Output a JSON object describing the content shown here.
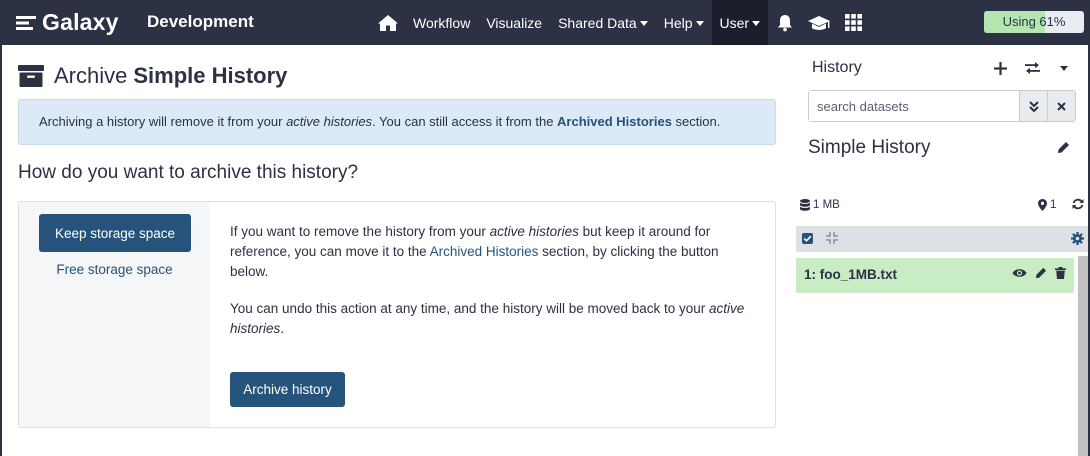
{
  "masthead": {
    "brand": "Galaxy",
    "subtitle": "Development",
    "nav": {
      "workflow": "Workflow",
      "visualize": "Visualize",
      "shared_data": "Shared Data",
      "help": "Help",
      "user": "User"
    },
    "icons": [
      "home-icon",
      "bell-icon",
      "graduation-cap-icon",
      "grid-apps-icon"
    ],
    "quota": {
      "label": "Using 61%",
      "percent": 61
    }
  },
  "main": {
    "title_prefix": "Archive",
    "title_name": "Simple History",
    "alert": {
      "part1": "Archiving a history will remove it from your ",
      "em": "active histories",
      "part2": ". You can still access it from the ",
      "strong": "Archived Histories",
      "part3": " section."
    },
    "question": "How do you want to archive this history?",
    "options": {
      "keep": "Keep storage space",
      "free": "Free storage space"
    },
    "body": {
      "p1_a": "If you want to remove the history from your ",
      "p1_em": "active histories",
      "p1_b": " but keep it around for reference, you can move it to the ",
      "p1_link": "Archived Histories",
      "p1_c": " section, by clicking the button below.",
      "p2_a": "You can undo this action at any time, and the history will be moved back to your ",
      "p2_em": "active histories",
      "p2_b": "."
    },
    "archive_button": "Archive history"
  },
  "history_panel": {
    "label": "History",
    "search_placeholder": "search datasets",
    "name": "Simple History",
    "size": "1 MB",
    "count": "1",
    "datasets": [
      {
        "title": "1: foo_1MB.txt",
        "state": "ok"
      }
    ]
  },
  "colors": {
    "masthead": "#2c3143",
    "primary": "#25537b",
    "alert_bg": "#dbeaf6",
    "dataset_ok": "#c8ecc4",
    "quota_fill": "#b6e6b0"
  }
}
